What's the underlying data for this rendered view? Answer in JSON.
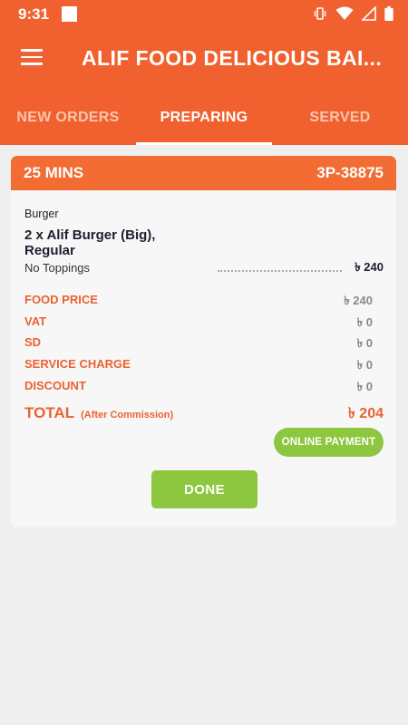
{
  "status_bar": {
    "time": "9:31",
    "icons": [
      "notification-square-icon",
      "vibrate-icon",
      "wifi-icon",
      "signal-icon",
      "battery-icon"
    ]
  },
  "app_bar": {
    "title": "ALIF FOOD DELICIOUS BAI...",
    "menu_icon": "hamburger-menu-icon"
  },
  "tabs": [
    {
      "label": "NEW ORDERS",
      "active": false
    },
    {
      "label": "PREPARING",
      "active": true
    },
    {
      "label": "SERVED",
      "active": false
    }
  ],
  "order": {
    "time_label": "25 MINS",
    "order_id": "3P-38875",
    "category": "Burger",
    "item_name": "2 x Alif Burger (Big), Regular",
    "toppings": "No Toppings",
    "item_price": "৳ 240",
    "summary": [
      {
        "label": "FOOD PRICE",
        "value": "৳ 240"
      },
      {
        "label": "VAT",
        "value": "৳ 0"
      },
      {
        "label": "SD",
        "value": "৳ 0"
      },
      {
        "label": "SERVICE CHARGE",
        "value": "৳ 0"
      },
      {
        "label": "DISCOUNT",
        "value": "৳ 0"
      }
    ],
    "total_label": "TOTAL",
    "total_note": "(After Commission)",
    "total_value": "৳ 204",
    "payment_label": "ONLINE PAYMENT",
    "done_label": "DONE"
  },
  "colors": {
    "brand_orange": "#f0612f",
    "accent_green": "#8dc63f",
    "summary_label": "#ea6232"
  }
}
